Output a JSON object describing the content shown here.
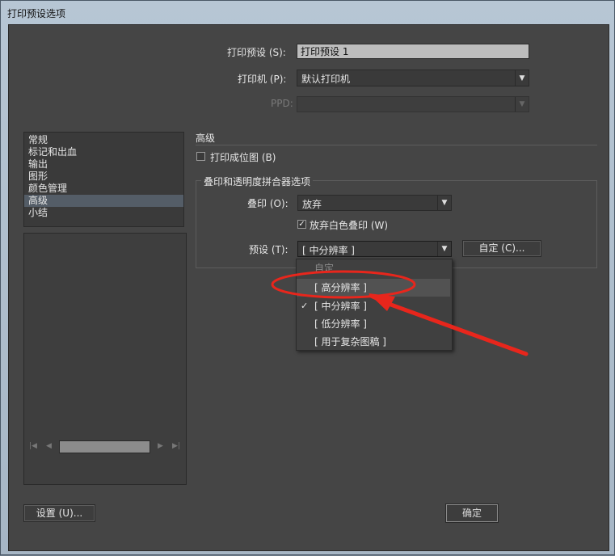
{
  "window": {
    "title": "打印预设选项"
  },
  "header": {
    "preset_label": "打印预设 (S):",
    "preset_value": "打印预设 1",
    "printer_label": "打印机 (P):",
    "printer_value": "默认打印机",
    "ppd_label": "PPD:",
    "ppd_value": ""
  },
  "sidebar": {
    "items": [
      {
        "label": "常规"
      },
      {
        "label": "标记和出血"
      },
      {
        "label": "输出"
      },
      {
        "label": "图形"
      },
      {
        "label": "颜色管理"
      },
      {
        "label": "高级",
        "selected": true
      },
      {
        "label": "小结"
      }
    ]
  },
  "preview": {
    "first_icon": "first-page-icon",
    "prev_icon": "prev-page-icon",
    "next_icon": "next-page-icon",
    "last_icon": "last-page-icon"
  },
  "advanced": {
    "section_title": "高级",
    "print_as_bitmap_label": "打印成位图 (B)",
    "print_as_bitmap_checked": false,
    "group_title": "叠印和透明度拼合器选项",
    "overprint_label": "叠印 (O):",
    "overprint_value": "放弃",
    "discard_white_label": "放弃白色叠印 (W)",
    "discard_white_checked": true,
    "preset_label": "预设 (T):",
    "preset_value": "[ 中分辨率 ]",
    "custom_button": "自定 (C)..."
  },
  "dropdown": {
    "items": [
      {
        "label": "自定",
        "disabled": true
      },
      {
        "label": "[ 高分辨率 ]",
        "hover": true
      },
      {
        "label": "[ 中分辨率 ]",
        "checked": true
      },
      {
        "label": "[ 低分辨率 ]"
      },
      {
        "label": "[ 用于复杂图稿 ]"
      }
    ]
  },
  "footer": {
    "setup_button": "设置 (U)...",
    "ok_button_partial": "确定"
  },
  "colors": {
    "dialog_bg": "#454545",
    "annotation_red": "#e8261c"
  }
}
